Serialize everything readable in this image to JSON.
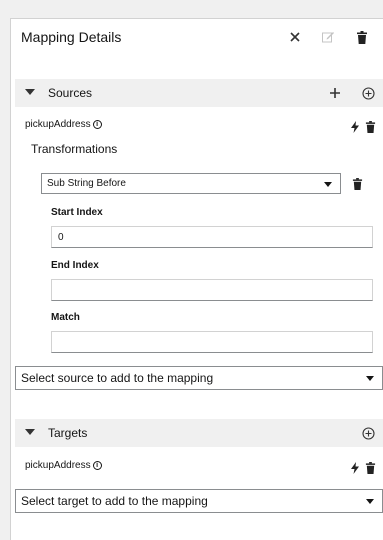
{
  "panel": {
    "title": "Mapping Details",
    "icons": {
      "close": "close-icon",
      "edit": "edit-icon",
      "delete": "trash-icon"
    }
  },
  "sources": {
    "label": "Sources",
    "field": "pickupAddress",
    "transformations_label": "Transformations",
    "transformation": {
      "selected": "Sub String Before",
      "start_index_label": "Start Index",
      "start_index_value": "0",
      "end_index_label": "End Index",
      "end_index_value": "",
      "match_label": "Match",
      "match_value": ""
    },
    "select_placeholder": "Select source to add to the mapping"
  },
  "targets": {
    "label": "Targets",
    "field": "pickupAddress",
    "select_placeholder": "Select target to add to the mapping"
  },
  "info_glyph": "i"
}
